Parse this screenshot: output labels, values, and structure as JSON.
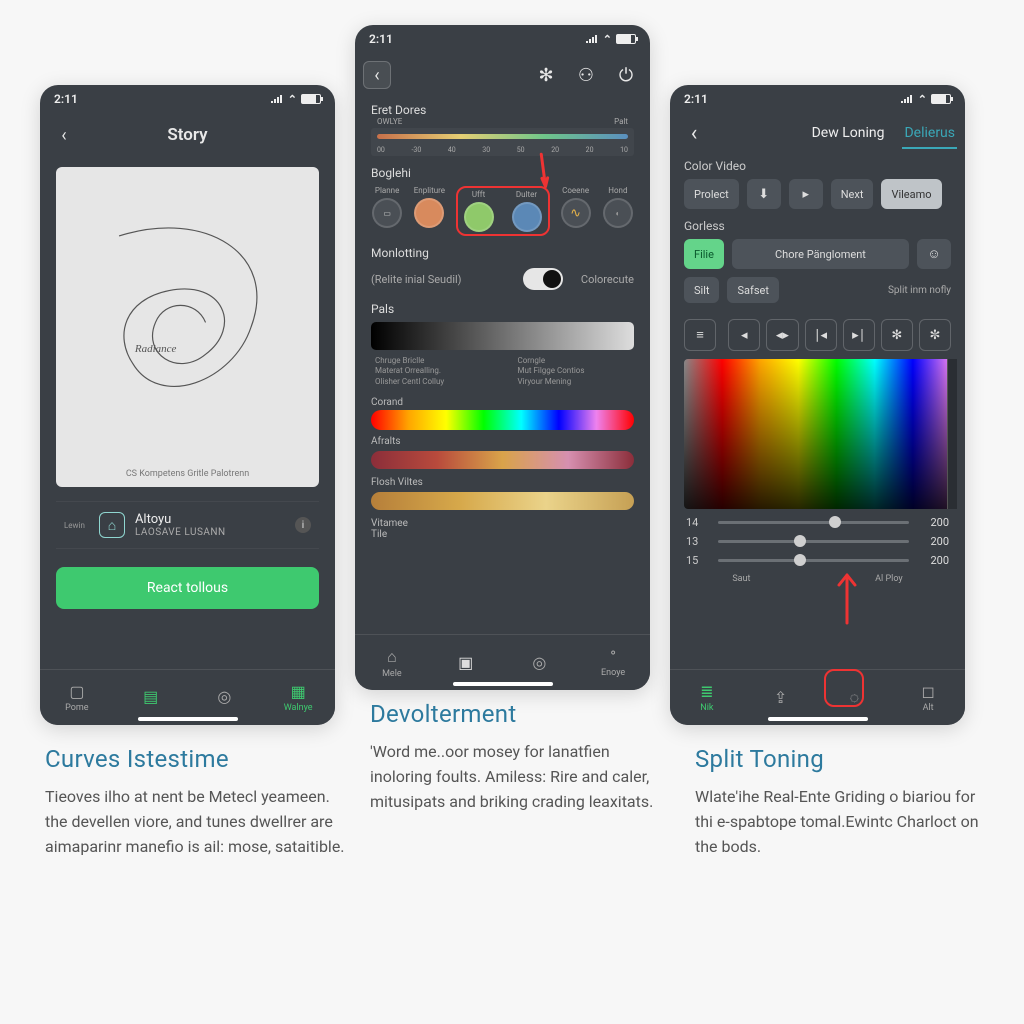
{
  "statusbar_time": "2:11",
  "phone1": {
    "title": "Story",
    "canvas_label": "Radiance",
    "canvas_caption": "CS Kompetens Gritle Palotrenn",
    "info_side": "Lewin",
    "info_name": "Altoyu",
    "info_sub": "LAOSAVE LUSANN",
    "cta": "React tollous",
    "tabs": [
      "Pome",
      "",
      "",
      "Walnye"
    ]
  },
  "phone2": {
    "section_eret": "Eret Dores",
    "ruler_left": "OWLYE",
    "ruler_right": "Palt",
    "ruler_ticks": [
      "00",
      "-30",
      "40",
      "30",
      "50",
      "20",
      "20",
      "10"
    ],
    "section_boglehi": "Boglehi",
    "chips": [
      "Planne",
      "Enpliture",
      "Ufft",
      "Dulter",
      "Coeene",
      "Hond"
    ],
    "section_monlatting": "Monlotting",
    "monlot_sub": "(Relite inial Seudil)",
    "monlot_right": "Colorecute",
    "section_pals": "Pals",
    "gradnote_left": "Chruge Briclle\nMaterat Orrealling.\nOlisher Centl Colluy",
    "gradnote_right": "Corngle\nMut Filgge Contios\nViryour Mening",
    "section_corand": "Corand",
    "section_atalts": "Afralts",
    "section_flosh": "Flosh Viltes",
    "section_vitanse": "Vitamee",
    "section_tile": "Tile",
    "tabs": [
      "Mele",
      "",
      "",
      "Enoye"
    ]
  },
  "phone3": {
    "tab_main": "Dew Loning",
    "tab_active": "Delierus",
    "section_color": "Color Video",
    "pills_row1": [
      "Prolect",
      "",
      "",
      "Next",
      "Vileamo"
    ],
    "section_gorless": "Gorless",
    "pill_file": "Filie",
    "pill_chore": "Chore Pängloment",
    "pill_silt": "Silt",
    "pill_satset": "Safset",
    "split_label": "Split inm nofly",
    "sliders": [
      {
        "lab": "14",
        "val": "200",
        "pos": 58
      },
      {
        "lab": "13",
        "val": "200",
        "pos": 40
      },
      {
        "lab": "15",
        "val": "200",
        "pos": 40
      }
    ],
    "slabels": [
      "Saut",
      "Al Ploy"
    ],
    "tabs": [
      "Nik",
      "",
      "",
      "Alt"
    ]
  },
  "captions": {
    "c1_title": "Curves Istestime",
    "c1_body": "Tieoves ilho at nent be Metecl yeameen. the devellen viore, and tunes dwellrer are aimaparinr manefio is ail: mose, sataitible.",
    "c2_title": "Devolterment",
    "c2_body": "'Word me..oor mosey for lanatfien inoloring foults. Amiless: Rire and caler, mitusipats and briking crading leaxitats.",
    "c3_title": "Split Toning",
    "c3_body": "Wlate'ihe Real-Ente Griding o biariou for thi e-spabtope tomal.Ewintc Charloct on the bods."
  }
}
